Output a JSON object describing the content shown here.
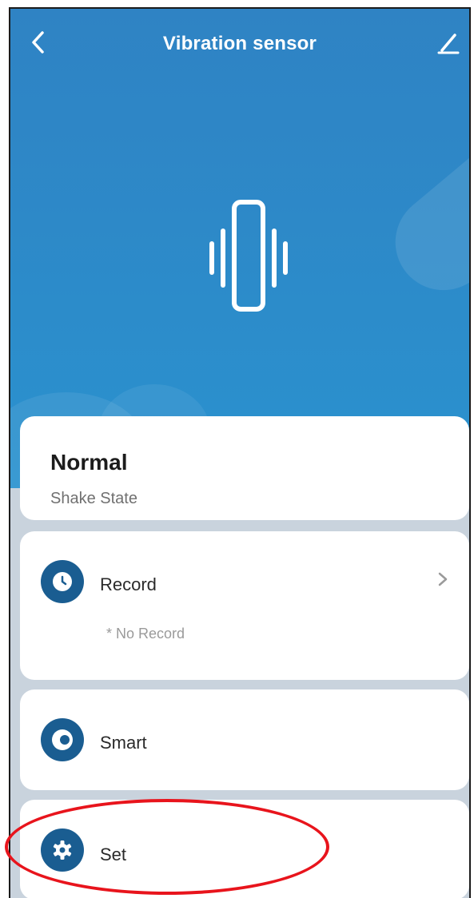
{
  "header": {
    "title": "Vibration sensor",
    "back_icon": "chevron-left-icon",
    "edit_icon": "pencil-icon"
  },
  "hero": {
    "icon": "vibration-sensor-icon"
  },
  "status": {
    "value": "Normal",
    "label": "Shake State"
  },
  "menu": [
    {
      "label": "Record",
      "icon": "clock-icon",
      "detail": "* No Record",
      "chevron": true
    },
    {
      "label": "Smart",
      "icon": "toggle-icon"
    },
    {
      "label": "Set",
      "icon": "gear-icon"
    }
  ],
  "colors": {
    "hero_top": "#2f83c4",
    "hero_bottom": "#2a92cf",
    "icon_circle": "#1a5d91",
    "highlight": "#e8141c"
  }
}
